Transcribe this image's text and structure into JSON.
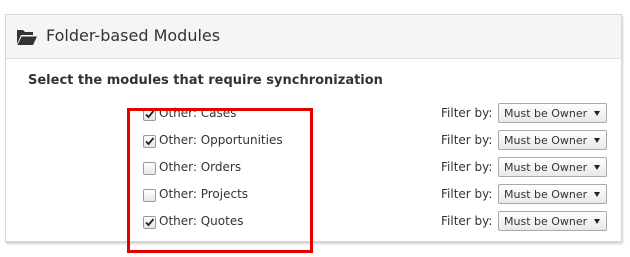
{
  "panel": {
    "title": "Folder-based Modules",
    "header_icon": "folder-open-icon",
    "section_label": "Select the modules that require synchronization"
  },
  "modules": [
    {
      "label": "Other: Cases",
      "checked": true,
      "filter_label": "Filter by:",
      "filter_value": "Must be Owner"
    },
    {
      "label": "Other: Opportunities",
      "checked": true,
      "filter_label": "Filter by:",
      "filter_value": "Must be Owner"
    },
    {
      "label": "Other: Orders",
      "checked": false,
      "filter_label": "Filter by:",
      "filter_value": "Must be Owner"
    },
    {
      "label": "Other: Projects",
      "checked": false,
      "filter_label": "Filter by:",
      "filter_value": "Must be Owner"
    },
    {
      "label": "Other: Quotes",
      "checked": true,
      "filter_label": "Filter by:",
      "filter_value": "Must be Owner"
    }
  ],
  "colors": {
    "highlight": "#e00000",
    "header_bg": "#f5f5f5",
    "text": "#333333"
  }
}
